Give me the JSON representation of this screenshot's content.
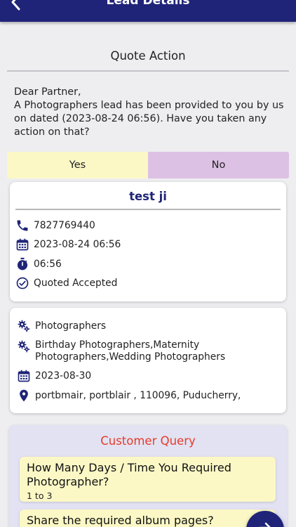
{
  "header": {
    "title": "Lead Details",
    "back_icon": "chevron-left-icon"
  },
  "quote_action": {
    "title": "Quote Action",
    "message_line1": "Dear Partner,",
    "message_line2": "A Photographers lead has been provided to you by us on dated (2023-08-24 06:56). Have you taken any action on that?",
    "yes_label": "Yes",
    "no_label": "No"
  },
  "lead_card": {
    "name": "test ji",
    "phone": "7827769440",
    "datetime": "2023-08-24 06:56",
    "time": "06:56",
    "status": "Quoted Accepted"
  },
  "details_card": {
    "category": "Photographers",
    "services": "Birthday Photographers,Maternity Photographers,Wedding Photographers",
    "event_date": "2023-08-30",
    "location": "portbmair, portblair , 110096, Puducherry,"
  },
  "customer_query": {
    "title": "Customer Query",
    "items": [
      {
        "question": "How Many Days / Time You Required Photographer?",
        "answer": "1 to 3"
      },
      {
        "question": "Share the required album pages?",
        "answer": ""
      }
    ]
  },
  "colors": {
    "primary": "#1f2478",
    "yes_bg": "#fbf8c6",
    "no_bg": "#ddc1e4",
    "query_title": "#e63b2a"
  }
}
